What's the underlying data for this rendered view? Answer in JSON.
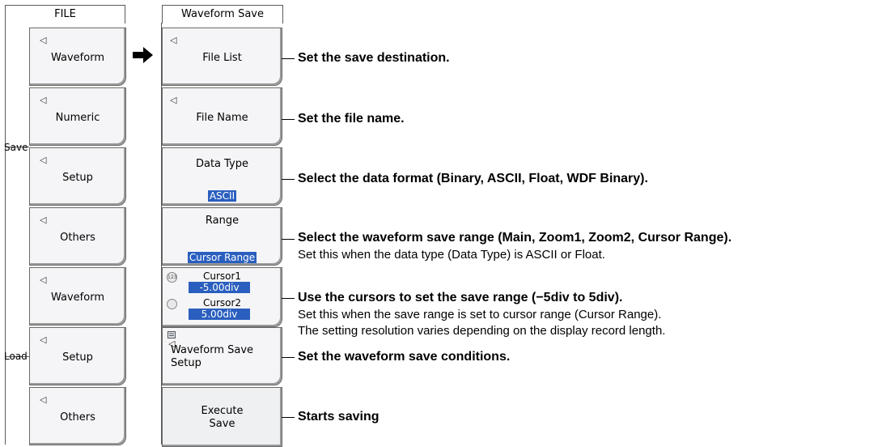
{
  "file_menu": {
    "title": "FILE",
    "group_save": "Save",
    "group_load": "Load",
    "items": [
      {
        "label": "Waveform"
      },
      {
        "label": "Numeric"
      },
      {
        "label": "Setup"
      },
      {
        "label": "Others"
      },
      {
        "label": "Waveform"
      },
      {
        "label": "Setup"
      },
      {
        "label": "Others"
      }
    ],
    "submenu_glyph": "◁"
  },
  "arrow_icon": "right-arrow-icon",
  "waveform_save": {
    "title": "Waveform Save",
    "file_list": "File List",
    "file_name": "File Name",
    "data_type_label": "Data Type",
    "data_type_value": "ASCII",
    "range_label": "Range",
    "range_value": "Cursor Range",
    "cursor1_label": "Cursor1",
    "cursor1_value": "-5.00div",
    "cursor2_label": "Cursor2",
    "cursor2_value": "5.00div",
    "setup_label_1": "Waveform Save",
    "setup_label_2": "Setup",
    "execute_label_1": "Execute",
    "execute_label_2": "Save"
  },
  "descriptions": {
    "file_list": "Set the save destination.",
    "file_name": "Set the file name.",
    "data_type": "Select the data format (Binary, ASCII, Float, WDF Binary).",
    "range_main": "Select the waveform save range (Main, Zoom1, Zoom2, Cursor Range).",
    "range_sub": "Set this when the data type (Data Type) is ASCII or Float.",
    "cursor_main": "Use the cursors to set the save range (−5div to 5div).",
    "cursor_sub1": "Set this when the save range is set to cursor range (Cursor Range).",
    "cursor_sub2": "The setting resolution varies depending on the display record length.",
    "setup": "Set the waveform save conditions.",
    "execute": "Starts saving"
  },
  "colors": {
    "highlight": "#2a5fbf",
    "button_face": "#f5f5f7"
  }
}
